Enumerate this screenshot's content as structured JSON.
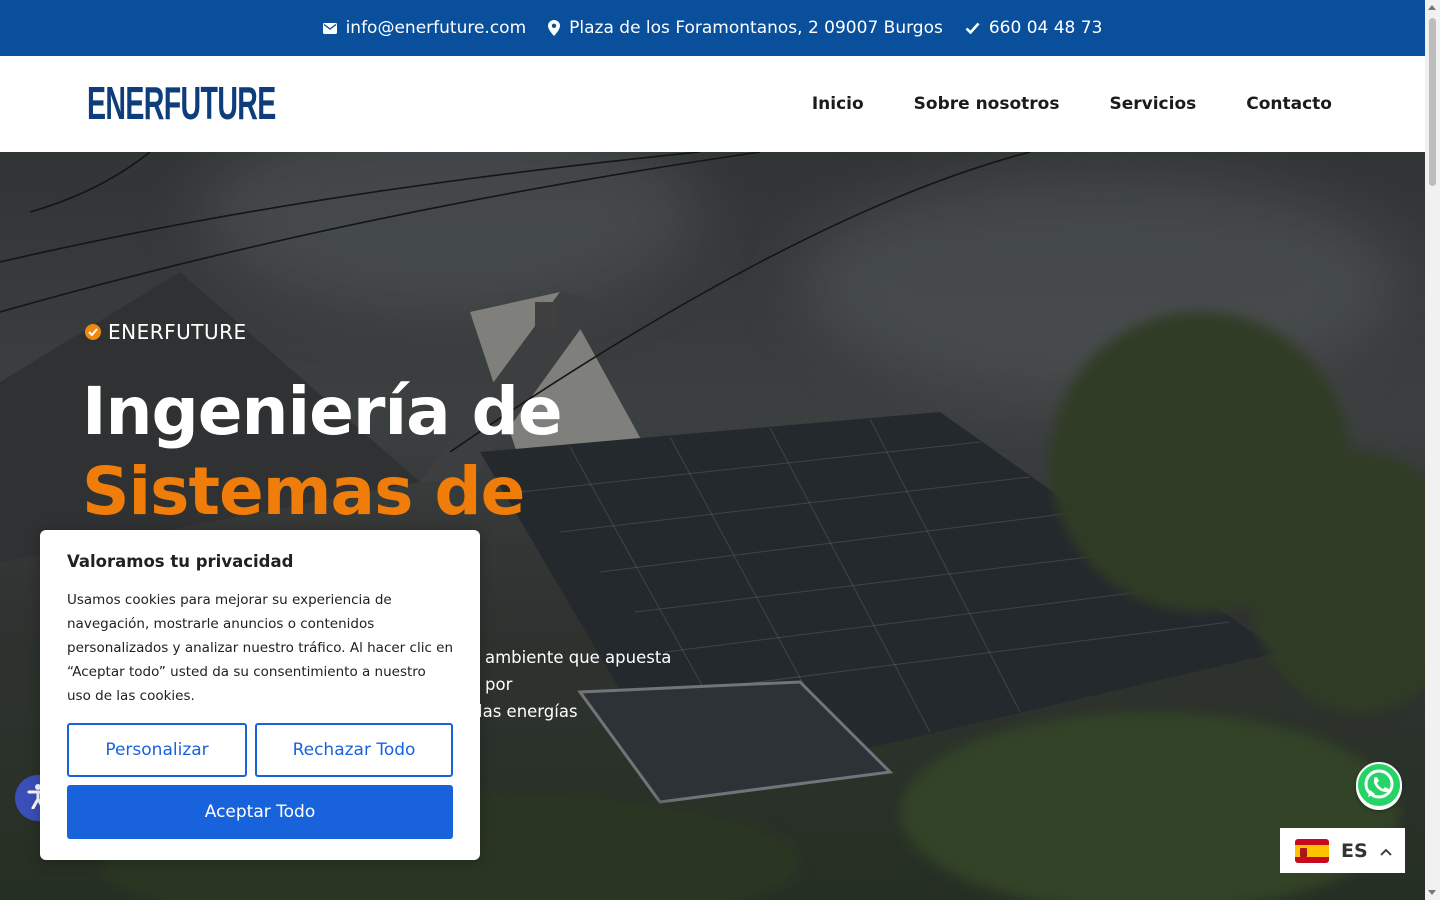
{
  "topbar": {
    "email": "info@enerfuture.com",
    "address": "Plaza de los Foramontanos, 2 09007 Burgos",
    "phone": "660 04 48 73"
  },
  "header": {
    "logo": "ENERFUTURE",
    "nav": [
      "Inicio",
      "Sobre nosotros",
      "Servicios",
      "Contacto"
    ]
  },
  "hero": {
    "eyebrow": "ENERFUTURE",
    "title_line1": "Ingeniería de",
    "title_line2": "Sistemas de",
    "text_line1": "ambiente que apuesta por",
    "text_line2": "las energías"
  },
  "cookie": {
    "title": "Valoramos tu privacidad",
    "body": "Usamos cookies para mejorar su experiencia de navegación, mostrarle anuncios o contenidos personalizados y analizar nuestro tráfico. Al hacer clic en “Aceptar todo” usted da su consentimiento a nuestro uso de las cookies.",
    "customize": "Personalizar",
    "reject": "Rechazar Todo",
    "accept": "Aceptar Todo"
  },
  "language": {
    "code": "ES"
  },
  "colors": {
    "brand_blue": "#0a4f9c",
    "accent_orange": "#f07d0a",
    "cookie_blue": "#1863dc"
  }
}
